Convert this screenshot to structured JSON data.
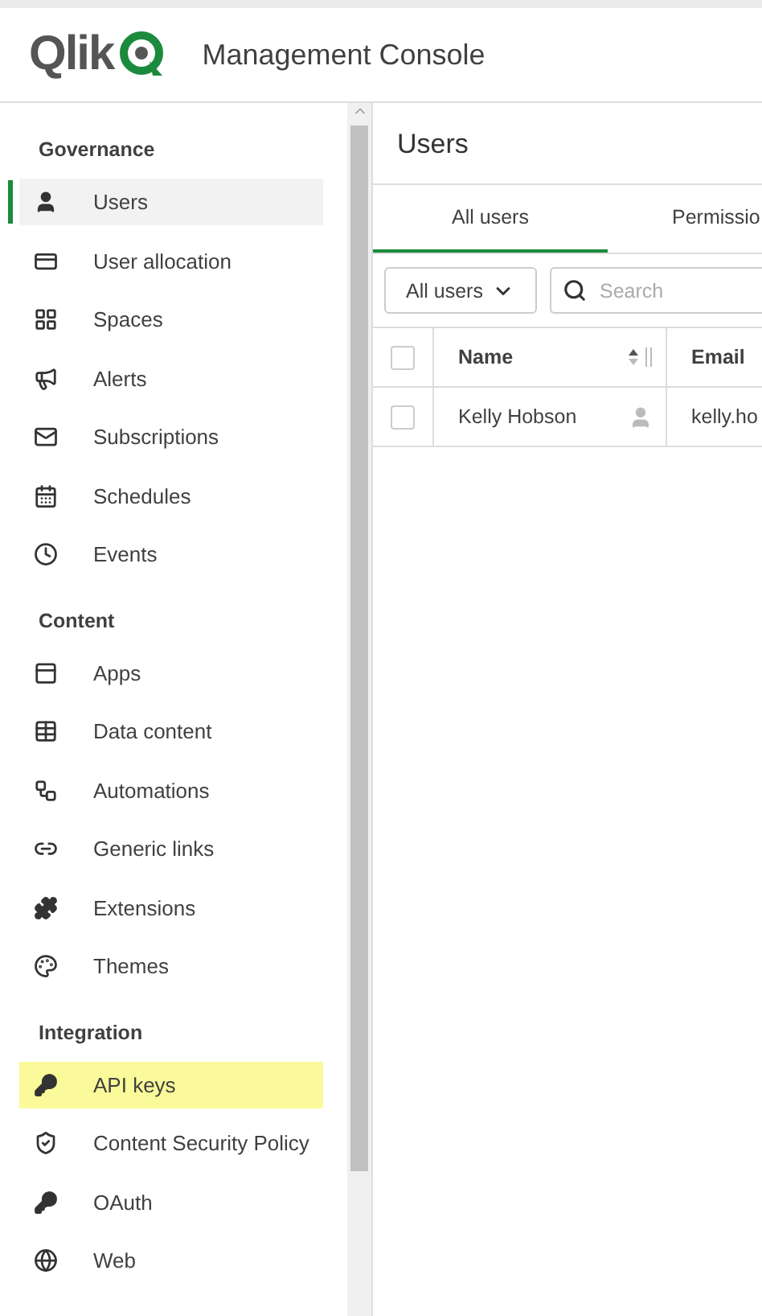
{
  "header": {
    "logo": "Qlik",
    "title": "Management Console"
  },
  "sidebar": {
    "sections": [
      {
        "title": "Governance",
        "items": [
          {
            "label": "Users",
            "selected": true,
            "highlighted": false
          },
          {
            "label": "User allocation",
            "selected": false,
            "highlighted": false
          },
          {
            "label": "Spaces",
            "selected": false,
            "highlighted": false
          },
          {
            "label": "Alerts",
            "selected": false,
            "highlighted": false
          },
          {
            "label": "Subscriptions",
            "selected": false,
            "highlighted": false
          },
          {
            "label": "Schedules",
            "selected": false,
            "highlighted": false
          },
          {
            "label": "Events",
            "selected": false,
            "highlighted": false
          }
        ]
      },
      {
        "title": "Content",
        "items": [
          {
            "label": "Apps",
            "selected": false,
            "highlighted": false
          },
          {
            "label": "Data content",
            "selected": false,
            "highlighted": false
          },
          {
            "label": "Automations",
            "selected": false,
            "highlighted": false
          },
          {
            "label": "Generic links",
            "selected": false,
            "highlighted": false
          },
          {
            "label": "Extensions",
            "selected": false,
            "highlighted": false
          },
          {
            "label": "Themes",
            "selected": false,
            "highlighted": false
          }
        ]
      },
      {
        "title": "Integration",
        "items": [
          {
            "label": "API keys",
            "selected": false,
            "highlighted": true
          },
          {
            "label": "Content Security Policy",
            "selected": false,
            "highlighted": false
          },
          {
            "label": "OAuth",
            "selected": false,
            "highlighted": false
          },
          {
            "label": "Web",
            "selected": false,
            "highlighted": false
          }
        ]
      }
    ]
  },
  "main": {
    "title": "Users",
    "tabs": [
      {
        "label": "All users",
        "selected": true
      },
      {
        "label": "Permissio",
        "selected": false
      }
    ],
    "filter": {
      "value": "All users"
    },
    "search": {
      "placeholder": "Search"
    },
    "table": {
      "select_all": {
        "checked": false
      },
      "columns": [
        "Name",
        "Email"
      ],
      "rows": [
        {
          "name": "Kelly Hobson",
          "email": "kelly.ho",
          "checked": false
        }
      ]
    }
  }
}
